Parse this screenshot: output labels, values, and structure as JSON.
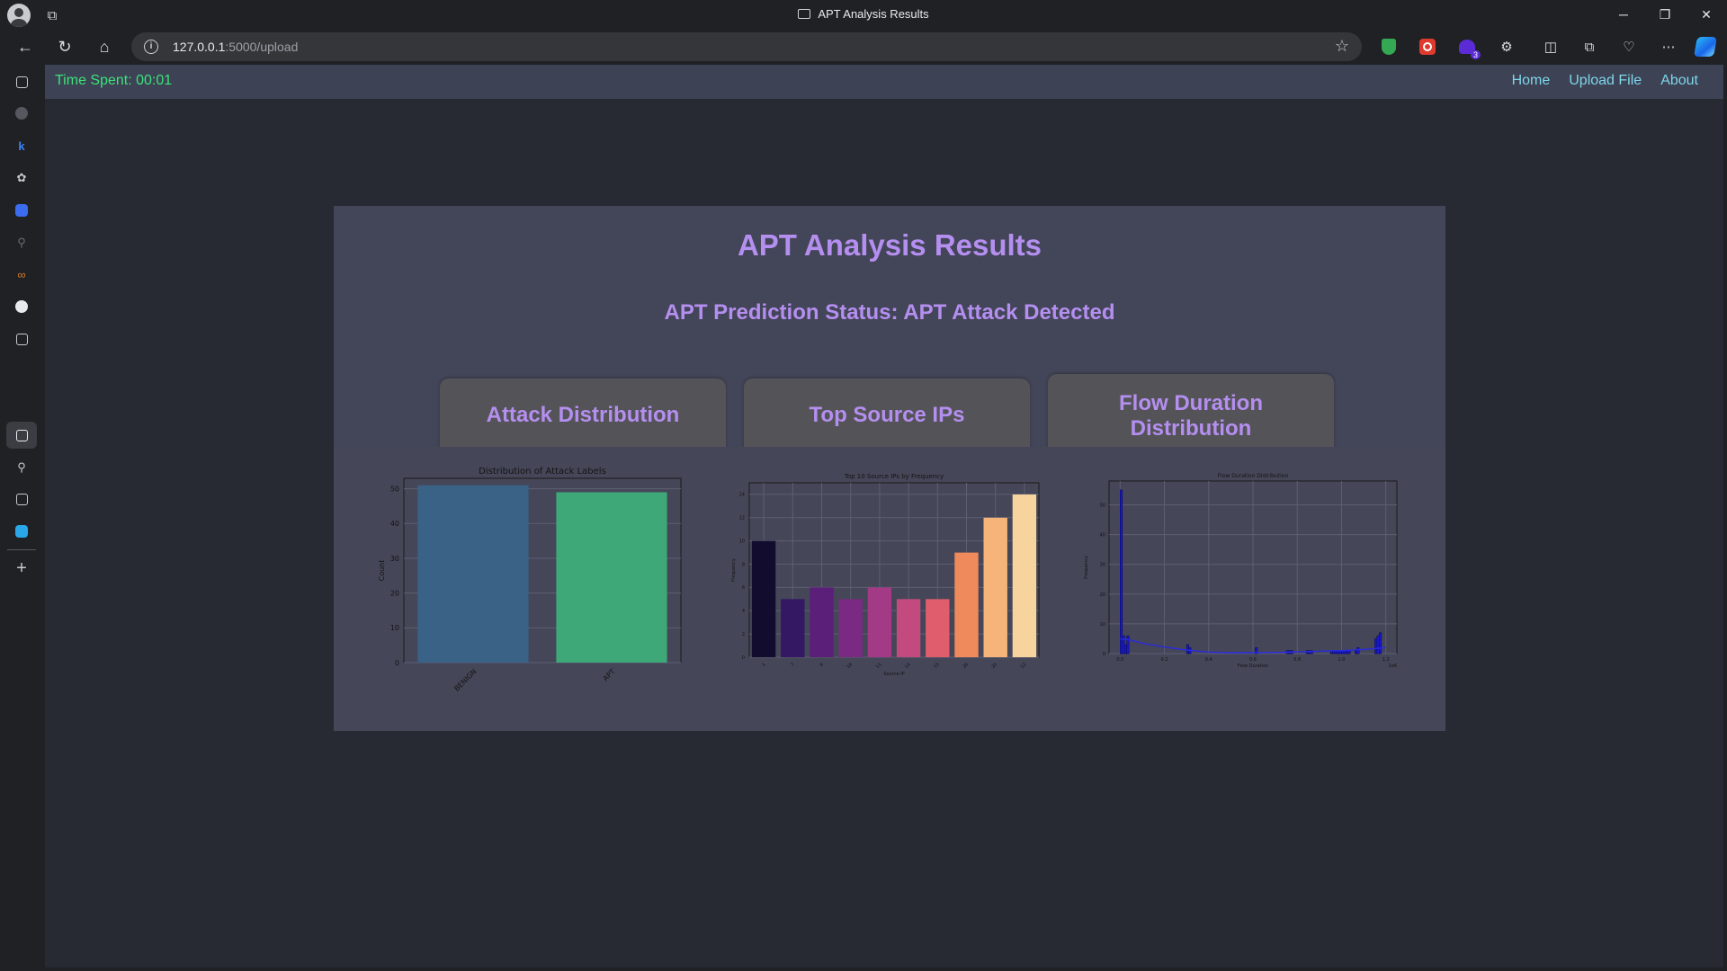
{
  "window": {
    "title": "APT Analysis Results"
  },
  "address_bar": {
    "host": "127.0.0.1",
    "path": ":5000/upload"
  },
  "extensions": {
    "badge_count": "3"
  },
  "nav": {
    "timer": "Time Spent: 00:01",
    "links": [
      "Home",
      "Upload File",
      "About"
    ]
  },
  "main": {
    "title": "APT Analysis Results",
    "status": "APT Prediction Status: APT Attack Detected",
    "cards": [
      {
        "title": "Attack Distribution"
      },
      {
        "title": "Top Source IPs"
      },
      {
        "title": "Flow Duration Distribution"
      }
    ]
  },
  "chart_data": [
    {
      "type": "bar",
      "title": "Distribution of Attack Labels",
      "xlabel": "",
      "ylabel": "Count",
      "categories": [
        "BENIGN",
        "APT"
      ],
      "values": [
        51,
        49
      ],
      "ylim": [
        0,
        53
      ],
      "yticks": [
        0,
        10,
        20,
        30,
        40,
        50
      ],
      "colors": [
        "#3a6186",
        "#3ea878"
      ],
      "grid": true
    },
    {
      "type": "bar",
      "title": "Top 10 Source IPs by Frequency",
      "xlabel": "Source IP",
      "ylabel": "Frequency",
      "categories": [
        "1",
        "7",
        "6",
        "16",
        "11",
        "14",
        "15",
        "26",
        "20",
        "12"
      ],
      "values": [
        10,
        5,
        6,
        5,
        6,
        5,
        5,
        9,
        12,
        14
      ],
      "ylim": [
        0,
        15
      ],
      "yticks": [
        0,
        2,
        4,
        6,
        8,
        10,
        12,
        14
      ],
      "colors": [
        "#120d2e",
        "#341863",
        "#5b1f7a",
        "#7a2a82",
        "#a33a86",
        "#c34a7e",
        "#df5d6c",
        "#ef8a5c",
        "#f6b47a",
        "#f7d49e"
      ],
      "grid": true
    },
    {
      "type": "bar",
      "title": "Flow Duration Distribution",
      "xlabel": "Flow Duration",
      "ylabel": "Frequency",
      "x_offset_label": "1e6",
      "bin_centers": [
        0.005,
        0.015,
        0.025,
        0.035,
        0.045,
        0.055,
        0.065,
        0.075,
        0.085,
        0.095,
        0.105,
        0.115,
        0.125,
        0.135,
        0.145,
        0.155,
        0.165,
        0.175,
        0.185,
        0.195,
        0.205,
        0.215,
        0.225,
        0.235,
        0.245,
        0.255,
        0.265,
        0.275,
        0.285,
        0.295,
        0.305,
        0.315,
        0.325,
        0.335,
        0.345,
        0.355,
        0.365,
        0.375,
        0.385,
        0.395,
        0.405,
        0.415,
        0.425,
        0.435,
        0.445,
        0.455,
        0.465,
        0.475,
        0.485,
        0.495,
        0.505,
        0.515,
        0.525,
        0.535,
        0.545,
        0.555,
        0.565,
        0.575,
        0.585,
        0.595,
        0.605,
        0.615,
        0.625,
        0.635,
        0.645,
        0.655,
        0.665,
        0.675,
        0.685,
        0.695,
        0.705,
        0.715,
        0.725,
        0.735,
        0.745,
        0.755,
        0.765,
        0.775,
        0.785,
        0.795,
        0.805,
        0.815,
        0.825,
        0.835,
        0.845,
        0.855,
        0.865,
        0.875,
        0.885,
        0.895,
        0.905,
        0.915,
        0.925,
        0.935,
        0.945,
        0.955,
        0.965,
        0.975,
        0.985,
        0.995,
        1.005,
        1.015,
        1.025,
        1.035,
        1.045,
        1.055,
        1.065,
        1.075,
        1.085,
        1.095,
        1.105,
        1.115,
        1.125,
        1.135,
        1.145,
        1.155,
        1.165,
        1.175,
        1.185,
        1.195
      ],
      "values": [
        55,
        6,
        3,
        6,
        0,
        0,
        0,
        0,
        0,
        0,
        0,
        0,
        0,
        0,
        0,
        0,
        0,
        0,
        0,
        0,
        0,
        0,
        0,
        0,
        0,
        0,
        0,
        0,
        0,
        0,
        3,
        2,
        0,
        0,
        0,
        0,
        0,
        0,
        0,
        0,
        0,
        0,
        0,
        0,
        0,
        0,
        0,
        0,
        0,
        0,
        0,
        0,
        0,
        0,
        0,
        0,
        0,
        0,
        0,
        0,
        0,
        2,
        0,
        0,
        0,
        0,
        0,
        0,
        0,
        0,
        0,
        0,
        0,
        0,
        0,
        1,
        1,
        1,
        0,
        0,
        0,
        0,
        0,
        0,
        1,
        1,
        1,
        0,
        0,
        0,
        0,
        0,
        0,
        0,
        0,
        1,
        1,
        1,
        1,
        1,
        1,
        1,
        1,
        1,
        0,
        0,
        1,
        2,
        0,
        0,
        0,
        0,
        0,
        0,
        0,
        5,
        6,
        7,
        0,
        0
      ],
      "kde": [
        [
          0.0,
          5
        ],
        [
          0.05,
          4.5
        ],
        [
          0.1,
          3.5
        ],
        [
          0.2,
          2.2
        ],
        [
          0.3,
          1.2
        ],
        [
          0.4,
          0.5
        ],
        [
          0.5,
          0.3
        ],
        [
          0.6,
          0.3
        ],
        [
          0.7,
          0.4
        ],
        [
          0.8,
          0.6
        ],
        [
          0.9,
          0.8
        ],
        [
          1.0,
          1.0
        ],
        [
          1.1,
          1.4
        ],
        [
          1.2,
          2.0
        ]
      ],
      "xlim": [
        -0.05,
        1.25
      ],
      "ylim": [
        0,
        58
      ],
      "xticks": [
        "0.0",
        "0.2",
        "0.4",
        "0.6",
        "0.8",
        "1.0",
        "1.2"
      ],
      "yticks": [
        0,
        10,
        20,
        30,
        40,
        50
      ],
      "colors": [
        "#1a1acc"
      ],
      "grid": true
    }
  ]
}
